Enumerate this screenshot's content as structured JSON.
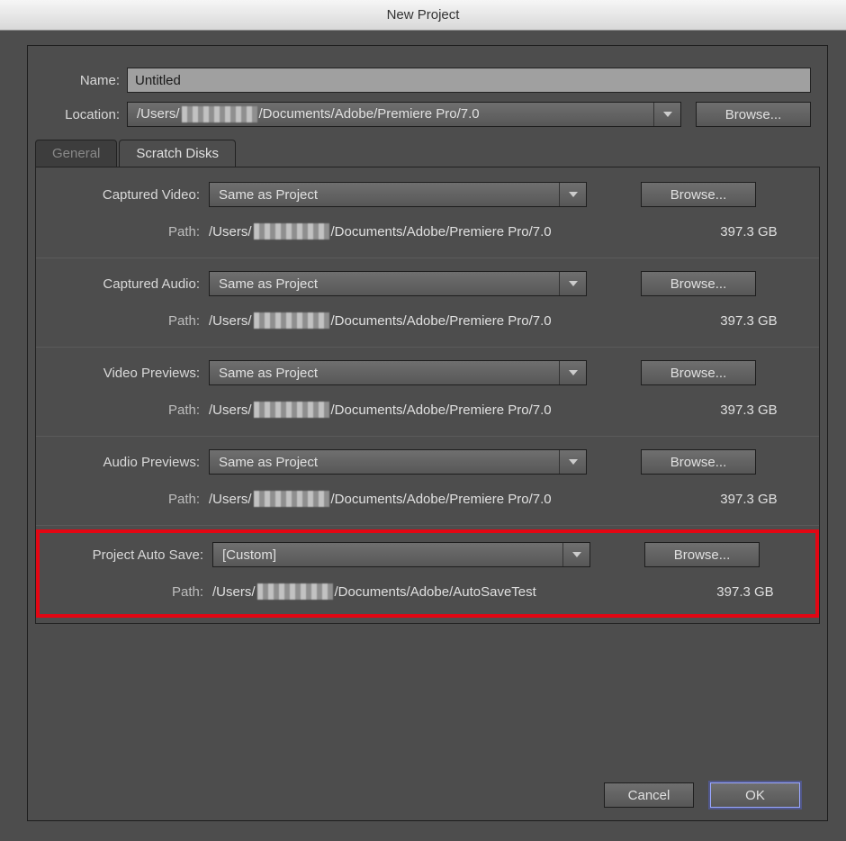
{
  "title": "New Project",
  "name": {
    "label": "Name:",
    "value": "Untitled"
  },
  "location": {
    "label": "Location:",
    "value_pre": "/Users/",
    "value_post": "/Documents/Adobe/Premiere Pro/7.0",
    "browse": "Browse..."
  },
  "tabs": {
    "general": "General",
    "scratch": "Scratch Disks"
  },
  "dropdown_same": "Same as Project",
  "dropdown_custom": "[Custom]",
  "browse": "Browse...",
  "path_label": "Path:",
  "path_pre": "/Users/",
  "path_post": "/Documents/Adobe/Premiere Pro/7.0",
  "autosave_post": "/Documents/Adobe/AutoSaveTest",
  "disk_size": "397.3 GB",
  "sections": {
    "captured_video": "Captured Video:",
    "captured_audio": "Captured Audio:",
    "video_previews": "Video Previews:",
    "audio_previews": "Audio Previews:",
    "project_autosave": "Project Auto Save:"
  },
  "footer": {
    "cancel": "Cancel",
    "ok": "OK"
  }
}
